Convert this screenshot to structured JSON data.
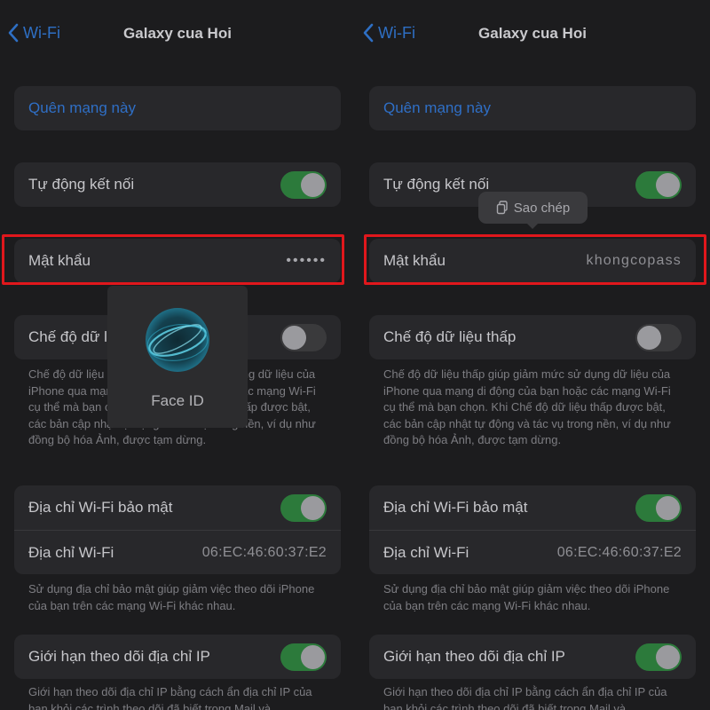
{
  "left": {
    "nav": {
      "back_label": "Wi-Fi",
      "title": "Galaxy cua Hoi"
    },
    "forget_label": "Quên mạng này",
    "auto_join": {
      "label": "Tự động kết nối",
      "on": true
    },
    "password": {
      "label": "Mật khẩu",
      "value": "••••••"
    },
    "low_data": {
      "label": "Chế độ dữ li",
      "on": false
    },
    "low_data_note": "Chế độ dữ liệu thấp giúp giảm mức sử dụng dữ liệu của iPhone qua mạng di động của bạn hoặc các mạng Wi-Fi cụ thể mà bạn chọn. Khi Chế độ dữ liệu thấp được bật, các bản cập nhật tự động và tác vụ trong nền, ví dụ như đồng bộ hóa Ảnh, được tạm dừng.",
    "private_address": {
      "label": "Địa chỉ Wi-Fi bảo mật",
      "on": true
    },
    "wifi_address": {
      "label": "Địa chỉ Wi-Fi",
      "value": "06:EC:46:60:37:E2"
    },
    "private_note": "Sử dụng địa chỉ bảo mật giúp giảm việc theo dõi iPhone của bạn trên các mạng Wi-Fi khác nhau.",
    "limit_ip": {
      "label": "Giới hạn theo dõi địa chỉ IP",
      "on": true
    },
    "limit_note": "Giới hạn theo dõi địa chỉ IP bằng cách ẩn địa chỉ IP của bạn khỏi các trình theo dõi đã biết trong Mail và",
    "faceid_label": "Face ID"
  },
  "right": {
    "nav": {
      "back_label": "Wi-Fi",
      "title": "Galaxy cua Hoi"
    },
    "forget_label": "Quên mạng này",
    "auto_join": {
      "label": "Tự động kết nối",
      "on": true
    },
    "password": {
      "label": "Mật khẩu",
      "value": "khongcopass"
    },
    "copy_label": "Sao chép",
    "low_data": {
      "label": "Chế độ dữ liệu thấp",
      "on": false
    },
    "low_data_note": "Chế độ dữ liệu thấp giúp giảm mức sử dụng dữ liệu của iPhone qua mạng di động của bạn hoặc các mạng Wi-Fi cụ thể mà bạn chọn. Khi Chế độ dữ liệu thấp được bật, các bản cập nhật tự động và tác vụ trong nền, ví dụ như đồng bộ hóa Ảnh, được tạm dừng.",
    "private_address": {
      "label": "Địa chỉ Wi-Fi bảo mật",
      "on": true
    },
    "wifi_address": {
      "label": "Địa chỉ Wi-Fi",
      "value": "06:EC:46:60:37:E2"
    },
    "private_note": "Sử dụng địa chỉ bảo mật giúp giảm việc theo dõi iPhone của bạn trên các mạng Wi-Fi khác nhau.",
    "limit_ip": {
      "label": "Giới hạn theo dõi địa chỉ IP",
      "on": true
    },
    "limit_note": "Giới hạn theo dõi địa chỉ IP bằng cách ẩn địa chỉ IP của bạn khỏi các trình theo dõi đã biết trong Mail và"
  },
  "colors": {
    "link": "#2f6fc6",
    "toggle_on": "#2c7a3b",
    "highlight": "#e0171c"
  },
  "icons": {
    "back": "chevron-left-icon",
    "faceid": "face-id-icon",
    "copy": "copy-icon"
  }
}
